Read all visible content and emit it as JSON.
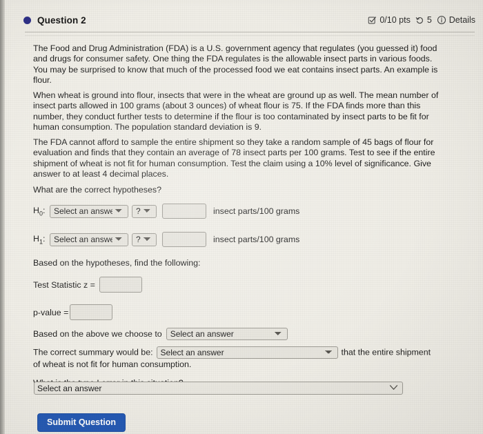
{
  "header": {
    "question_label": "Question 2",
    "points": "0/10 pts",
    "attempts": "5",
    "details_label": "Details",
    "dot_color": "#2b2d86",
    "icons": {
      "status": "checkbox-check-icon",
      "attempts": "history-undo-icon",
      "details": "info-circle-icon"
    }
  },
  "body": {
    "paragraph_1": "The Food and Drug Administration (FDA) is a U.S. government agency that regulates (you guessed it) food and drugs for consumer safety. One thing the FDA regulates is the allowable insect parts in various foods. You may be surprised to know that much of the processed food we eat contains insect parts. An example is flour.",
    "paragraph_2": "When wheat is ground into flour, insects that were in the wheat are ground up as well. The mean number of insect parts allowed in 100 grams (about 3 ounces) of wheat flour is 75. If the FDA finds more than this number, they conduct further tests to determine if the flour is too contaminated by insect parts to be fit for human consumption. The population standard deviation is 9.",
    "paragraph_3": "The FDA cannot afford to sample the entire shipment so they take a random sample of 45 bags of flour for evaluation and finds that they contain an average of 78 insect parts per 100 grams. Test to see if the entire shipment of wheat is not fit for human consumption. Test the claim using a 10% level of significance. Give answer to at least 4 decimal places."
  },
  "hypotheses": {
    "prompt": "What are the correct hypotheses?",
    "rows": [
      {
        "label": "H",
        "subscript": "0",
        "colon": ":",
        "answer_select_value": "Select an answer",
        "operator_select_value": "?",
        "value_input": "",
        "value_placeholder": "",
        "unit": "insect parts/100 grams"
      },
      {
        "label": "H",
        "subscript": "1",
        "colon": ":",
        "answer_select_value": "Select an answer",
        "operator_select_value": "?",
        "value_input": "",
        "value_placeholder": "",
        "unit": "insect parts/100 grams"
      }
    ]
  },
  "findings": {
    "prompt": "Based on the hypotheses, find the following:",
    "test_statistic_label": "Test Statistic z =",
    "test_statistic_value": "",
    "p_value_label": "p-value =",
    "p_value_value": ""
  },
  "decision": {
    "prompt": "Based on the above we choose to",
    "select_value": "Select an answer"
  },
  "summary": {
    "prefix": "The correct summary would be:",
    "select_value": "Select an answer",
    "suffix": "that the entire shipment",
    "tail": "of wheat is not fit for human consumption."
  },
  "type_one_error": {
    "prompt": "What is the type I error in this situation?",
    "select_value": "Select an answer"
  },
  "submit": {
    "label": "Submit Question",
    "color": "#2157b4"
  }
}
